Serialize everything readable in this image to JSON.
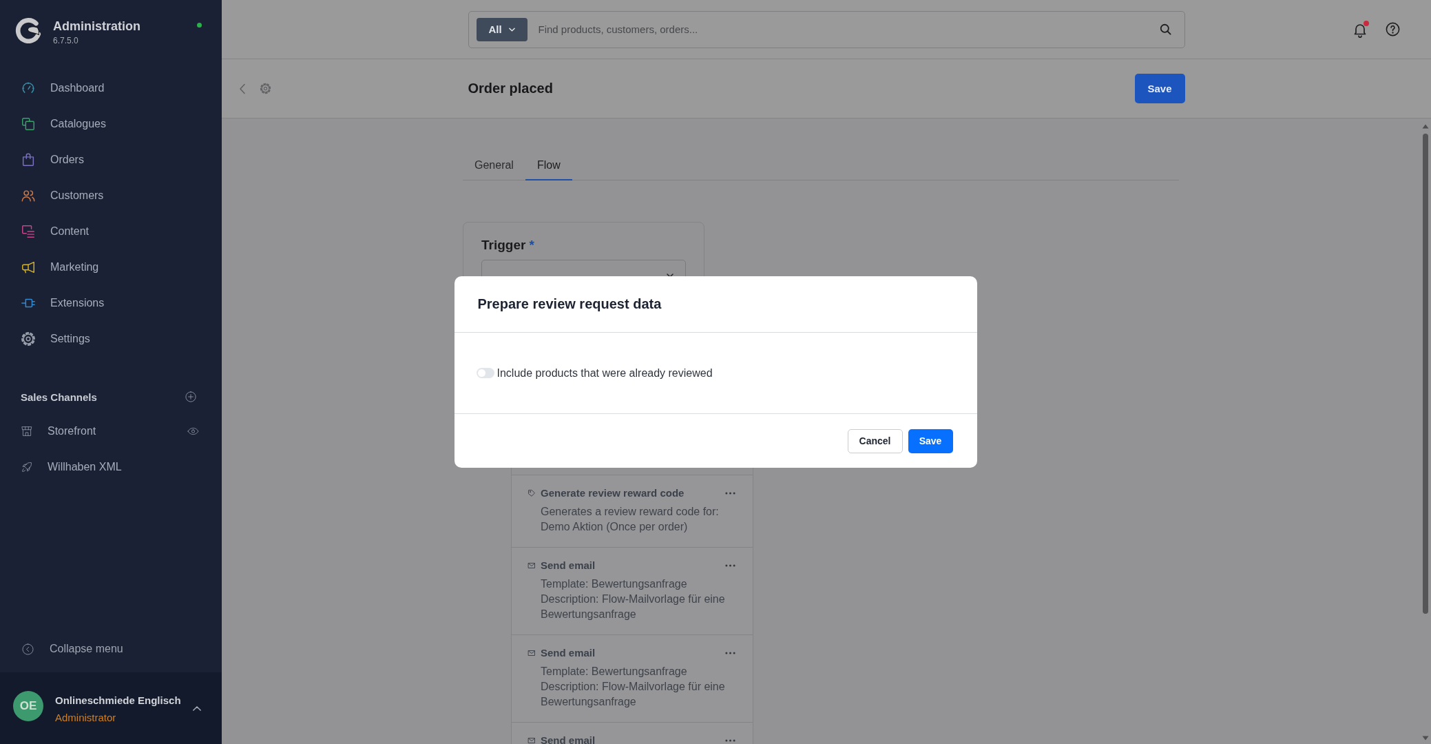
{
  "app": {
    "title": "Administration",
    "version": "6.7.5.0",
    "connected": true
  },
  "sidebar": {
    "items": [
      {
        "label": "Dashboard",
        "selected": false
      },
      {
        "label": "Catalogues",
        "selected": false
      },
      {
        "label": "Orders",
        "selected": false
      },
      {
        "label": "Customers",
        "selected": false
      },
      {
        "label": "Content",
        "selected": false
      },
      {
        "label": "Marketing",
        "selected": false
      },
      {
        "label": "Extensions",
        "selected": false
      },
      {
        "label": "Settings",
        "selected": false
      }
    ],
    "sales_channels": {
      "heading": "Sales Channels",
      "items": [
        {
          "label": "Storefront",
          "preview": true
        },
        {
          "label": "Willhaben XML",
          "preview": false
        }
      ]
    },
    "collapse": {
      "label": "Collapse menu"
    },
    "user": {
      "initials": "OE",
      "name": "Onlineschmiede Englisch",
      "role": "Administrator"
    }
  },
  "top_bar": {
    "search": {
      "scope": "All",
      "placeholder": "Find products, customers, orders..."
    },
    "notifications": {
      "unread": true
    }
  },
  "page_header": {
    "title": "Order placed",
    "save": "Save"
  },
  "tabs": [
    {
      "label": "General",
      "selected": false
    },
    {
      "label": "Flow",
      "selected": true
    }
  ],
  "trigger": {
    "label": "Trigger",
    "required_mark": "*"
  },
  "actions": [
    {
      "kind": "reward_code",
      "title": "Generate review reward code",
      "lines": [
        "Generates a review reward code for: Demo Aktion (Once per order)"
      ]
    },
    {
      "kind": "email",
      "title": "Send email",
      "lines": [
        "Template: Bewertungsanfrage",
        "Description: Flow-Mailvorlage für eine Bewertungsanfrage"
      ]
    },
    {
      "kind": "email",
      "title": "Send email",
      "lines": [
        "Template: Bewertungsanfrage",
        "Description: Flow-Mailvorlage für eine Bewertungsanfrage"
      ]
    },
    {
      "kind": "email",
      "title": "Send email"
    }
  ],
  "modal": {
    "title": "Prepare review request data",
    "options": [
      {
        "label": "Include products that were already reviewed",
        "on": false
      }
    ],
    "buttons": [
      {
        "label": "Cancel",
        "kind": "secondary"
      },
      {
        "label": "Save",
        "kind": "primary"
      }
    ]
  }
}
